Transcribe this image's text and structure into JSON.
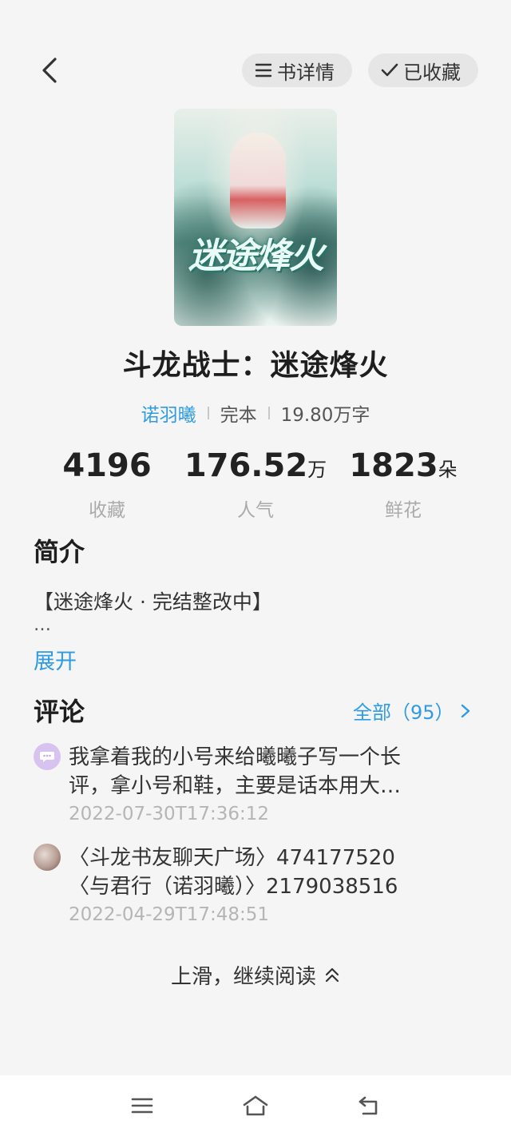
{
  "header": {
    "back_icon": "chevron-left-icon",
    "detail_label": "书详情",
    "detail_icon": "list-icon",
    "favorite_label": "已收藏",
    "favorite_icon": "check-icon"
  },
  "book": {
    "cover_title": "迷途烽火",
    "title": "斗龙战士：迷途烽火",
    "author": "诺羽曦",
    "status": "完本",
    "word_count": "19.80万字"
  },
  "stats": [
    {
      "value": "4196",
      "unit": "",
      "label": "收藏"
    },
    {
      "value": "176.52",
      "unit": "万",
      "label": "人气"
    },
    {
      "value": "1823",
      "unit": "朵",
      "label": "鲜花"
    }
  ],
  "intro": {
    "heading": "简介",
    "text": "【迷途烽火 · 完结整改中】",
    "ellipsis": "…",
    "expand_label": "展开"
  },
  "comments": {
    "heading": "评论",
    "all_label": "全部（95）",
    "items": [
      {
        "line1": "我拿着我的小号来给曦曦子写一个长",
        "line2": "评，拿小号和鞋，主要是话本用大…",
        "time": "2022-07-30T17:36:12"
      },
      {
        "line1": "〈斗龙书友聊天广场〉474177520",
        "line2": "〈与君行（诺羽曦）〉2179038516",
        "time": "2022-04-29T17:48:51"
      }
    ]
  },
  "footer": {
    "continue_label": "上滑，继续阅读"
  },
  "nav": {
    "menu_icon": "menu-icon",
    "home_icon": "home-icon",
    "back_icon": "back-icon"
  },
  "colors": {
    "accent": "#2f9be3",
    "background": "#f5f5f5",
    "pill": "#e6e6e6"
  }
}
